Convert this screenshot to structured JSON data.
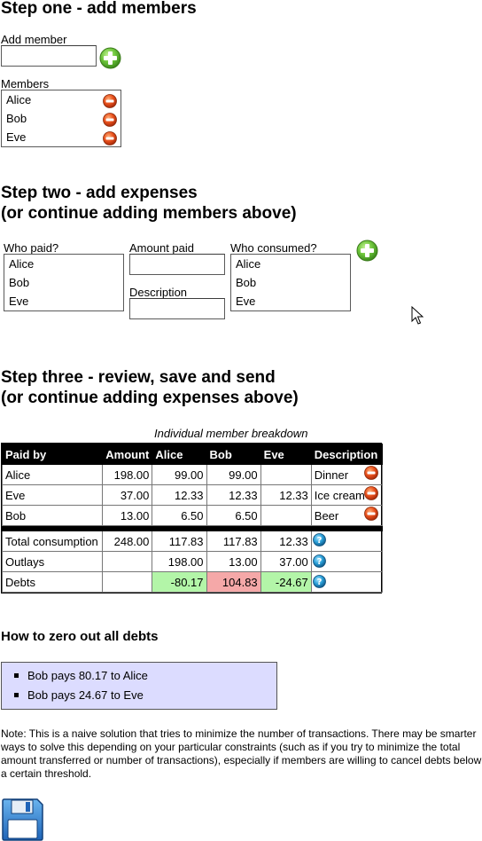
{
  "step1": {
    "heading": "Step one - add members",
    "add_member_label": "Add member",
    "add_member_value": "",
    "members_label": "Members",
    "members": [
      "Alice",
      "Bob",
      "Eve"
    ]
  },
  "step2": {
    "heading_line1": "Step two - add expenses",
    "heading_line2": "(or continue adding members above)",
    "who_paid_label": "Who paid?",
    "who_paid_options": [
      "Alice",
      "Bob",
      "Eve"
    ],
    "amount_label": "Amount paid",
    "amount_value": "",
    "description_label": "Description",
    "description_value": "",
    "who_consumed_label": "Who consumed?",
    "who_consumed_options": [
      "Alice",
      "Bob",
      "Eve"
    ]
  },
  "step3": {
    "heading_line1": "Step three - review, save and send",
    "heading_line2": "(or continue adding expenses above)",
    "caption": "Individual member breakdown",
    "columns": [
      "Paid by",
      "Amount",
      "Alice",
      "Bob",
      "Eve",
      "Description"
    ],
    "expenses": [
      {
        "paid_by": "Alice",
        "amount": "198.00",
        "alice": "99.00",
        "bob": "99.00",
        "eve": "",
        "description": "Dinner"
      },
      {
        "paid_by": "Eve",
        "amount": "37.00",
        "alice": "12.33",
        "bob": "12.33",
        "eve": "12.33",
        "description": "Ice cream"
      },
      {
        "paid_by": "Bob",
        "amount": "13.00",
        "alice": "6.50",
        "bob": "6.50",
        "eve": "",
        "description": "Beer"
      }
    ],
    "totals": [
      {
        "label": "Total consumption",
        "amount": "248.00",
        "alice": "117.83",
        "bob": "117.83",
        "eve": "12.33"
      },
      {
        "label": "Outlays",
        "amount": "",
        "alice": "198.00",
        "bob": "13.00",
        "eve": "37.00"
      },
      {
        "label": "Debts",
        "amount": "",
        "alice": "-80.17",
        "bob": "104.83",
        "eve": "-24.67"
      }
    ]
  },
  "zero_out": {
    "heading": "How to zero out all debts",
    "transactions": [
      "Bob pays 80.17 to Alice",
      "Bob pays 24.67 to Eve"
    ],
    "note": "Note: This is a naive solution that tries to minimize the number of transactions. There may be smarter ways to solve this depending on your particular constraints (such as if you try to minimize the total amount transferred or number of transactions), especially if members are willing to cancel debts below a certain threshold."
  },
  "icons": {
    "add": "plus-circle-icon",
    "remove": "minus-circle-icon",
    "help": "question-circle-icon",
    "save": "floppy-disk-icon",
    "cursor": "mouse-pointer-icon"
  },
  "colors": {
    "add_icon": "#5cb82e",
    "remove_icon": "#e04a1a",
    "help_icon": "#2a9fd8",
    "debt_negative": "#b3f5a8",
    "debt_positive": "#f5a8a8",
    "summary_background": "#dcdcff",
    "header_background": "#000000"
  }
}
